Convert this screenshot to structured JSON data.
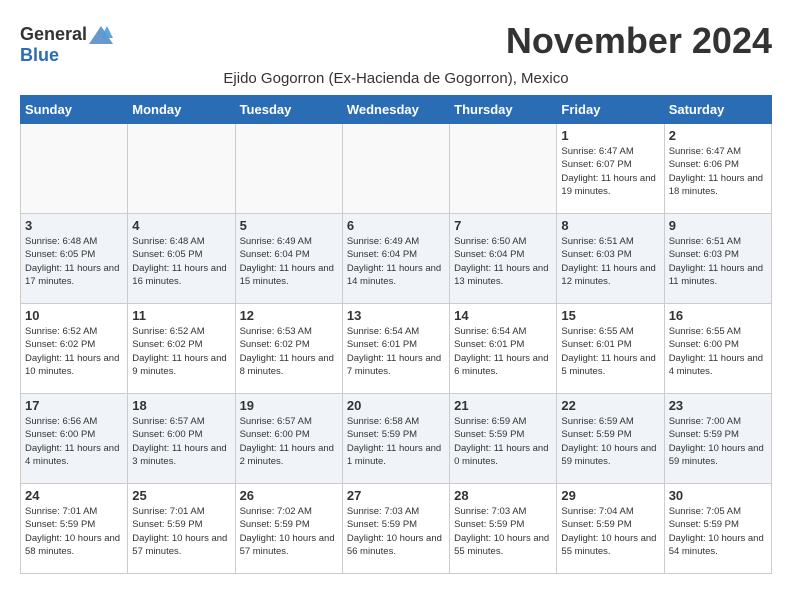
{
  "header": {
    "logo_general": "General",
    "logo_blue": "Blue",
    "month_title": "November 2024",
    "subtitle": "Ejido Gogorron (Ex-Hacienda de Gogorron), Mexico"
  },
  "days_of_week": [
    "Sunday",
    "Monday",
    "Tuesday",
    "Wednesday",
    "Thursday",
    "Friday",
    "Saturday"
  ],
  "weeks": [
    [
      {
        "num": "",
        "info": ""
      },
      {
        "num": "",
        "info": ""
      },
      {
        "num": "",
        "info": ""
      },
      {
        "num": "",
        "info": ""
      },
      {
        "num": "",
        "info": ""
      },
      {
        "num": "1",
        "info": "Sunrise: 6:47 AM\nSunset: 6:07 PM\nDaylight: 11 hours and 19 minutes."
      },
      {
        "num": "2",
        "info": "Sunrise: 6:47 AM\nSunset: 6:06 PM\nDaylight: 11 hours and 18 minutes."
      }
    ],
    [
      {
        "num": "3",
        "info": "Sunrise: 6:48 AM\nSunset: 6:05 PM\nDaylight: 11 hours and 17 minutes."
      },
      {
        "num": "4",
        "info": "Sunrise: 6:48 AM\nSunset: 6:05 PM\nDaylight: 11 hours and 16 minutes."
      },
      {
        "num": "5",
        "info": "Sunrise: 6:49 AM\nSunset: 6:04 PM\nDaylight: 11 hours and 15 minutes."
      },
      {
        "num": "6",
        "info": "Sunrise: 6:49 AM\nSunset: 6:04 PM\nDaylight: 11 hours and 14 minutes."
      },
      {
        "num": "7",
        "info": "Sunrise: 6:50 AM\nSunset: 6:04 PM\nDaylight: 11 hours and 13 minutes."
      },
      {
        "num": "8",
        "info": "Sunrise: 6:51 AM\nSunset: 6:03 PM\nDaylight: 11 hours and 12 minutes."
      },
      {
        "num": "9",
        "info": "Sunrise: 6:51 AM\nSunset: 6:03 PM\nDaylight: 11 hours and 11 minutes."
      }
    ],
    [
      {
        "num": "10",
        "info": "Sunrise: 6:52 AM\nSunset: 6:02 PM\nDaylight: 11 hours and 10 minutes."
      },
      {
        "num": "11",
        "info": "Sunrise: 6:52 AM\nSunset: 6:02 PM\nDaylight: 11 hours and 9 minutes."
      },
      {
        "num": "12",
        "info": "Sunrise: 6:53 AM\nSunset: 6:02 PM\nDaylight: 11 hours and 8 minutes."
      },
      {
        "num": "13",
        "info": "Sunrise: 6:54 AM\nSunset: 6:01 PM\nDaylight: 11 hours and 7 minutes."
      },
      {
        "num": "14",
        "info": "Sunrise: 6:54 AM\nSunset: 6:01 PM\nDaylight: 11 hours and 6 minutes."
      },
      {
        "num": "15",
        "info": "Sunrise: 6:55 AM\nSunset: 6:01 PM\nDaylight: 11 hours and 5 minutes."
      },
      {
        "num": "16",
        "info": "Sunrise: 6:55 AM\nSunset: 6:00 PM\nDaylight: 11 hours and 4 minutes."
      }
    ],
    [
      {
        "num": "17",
        "info": "Sunrise: 6:56 AM\nSunset: 6:00 PM\nDaylight: 11 hours and 4 minutes."
      },
      {
        "num": "18",
        "info": "Sunrise: 6:57 AM\nSunset: 6:00 PM\nDaylight: 11 hours and 3 minutes."
      },
      {
        "num": "19",
        "info": "Sunrise: 6:57 AM\nSunset: 6:00 PM\nDaylight: 11 hours and 2 minutes."
      },
      {
        "num": "20",
        "info": "Sunrise: 6:58 AM\nSunset: 5:59 PM\nDaylight: 11 hours and 1 minute."
      },
      {
        "num": "21",
        "info": "Sunrise: 6:59 AM\nSunset: 5:59 PM\nDaylight: 11 hours and 0 minutes."
      },
      {
        "num": "22",
        "info": "Sunrise: 6:59 AM\nSunset: 5:59 PM\nDaylight: 10 hours and 59 minutes."
      },
      {
        "num": "23",
        "info": "Sunrise: 7:00 AM\nSunset: 5:59 PM\nDaylight: 10 hours and 59 minutes."
      }
    ],
    [
      {
        "num": "24",
        "info": "Sunrise: 7:01 AM\nSunset: 5:59 PM\nDaylight: 10 hours and 58 minutes."
      },
      {
        "num": "25",
        "info": "Sunrise: 7:01 AM\nSunset: 5:59 PM\nDaylight: 10 hours and 57 minutes."
      },
      {
        "num": "26",
        "info": "Sunrise: 7:02 AM\nSunset: 5:59 PM\nDaylight: 10 hours and 57 minutes."
      },
      {
        "num": "27",
        "info": "Sunrise: 7:03 AM\nSunset: 5:59 PM\nDaylight: 10 hours and 56 minutes."
      },
      {
        "num": "28",
        "info": "Sunrise: 7:03 AM\nSunset: 5:59 PM\nDaylight: 10 hours and 55 minutes."
      },
      {
        "num": "29",
        "info": "Sunrise: 7:04 AM\nSunset: 5:59 PM\nDaylight: 10 hours and 55 minutes."
      },
      {
        "num": "30",
        "info": "Sunrise: 7:05 AM\nSunset: 5:59 PM\nDaylight: 10 hours and 54 minutes."
      }
    ]
  ]
}
